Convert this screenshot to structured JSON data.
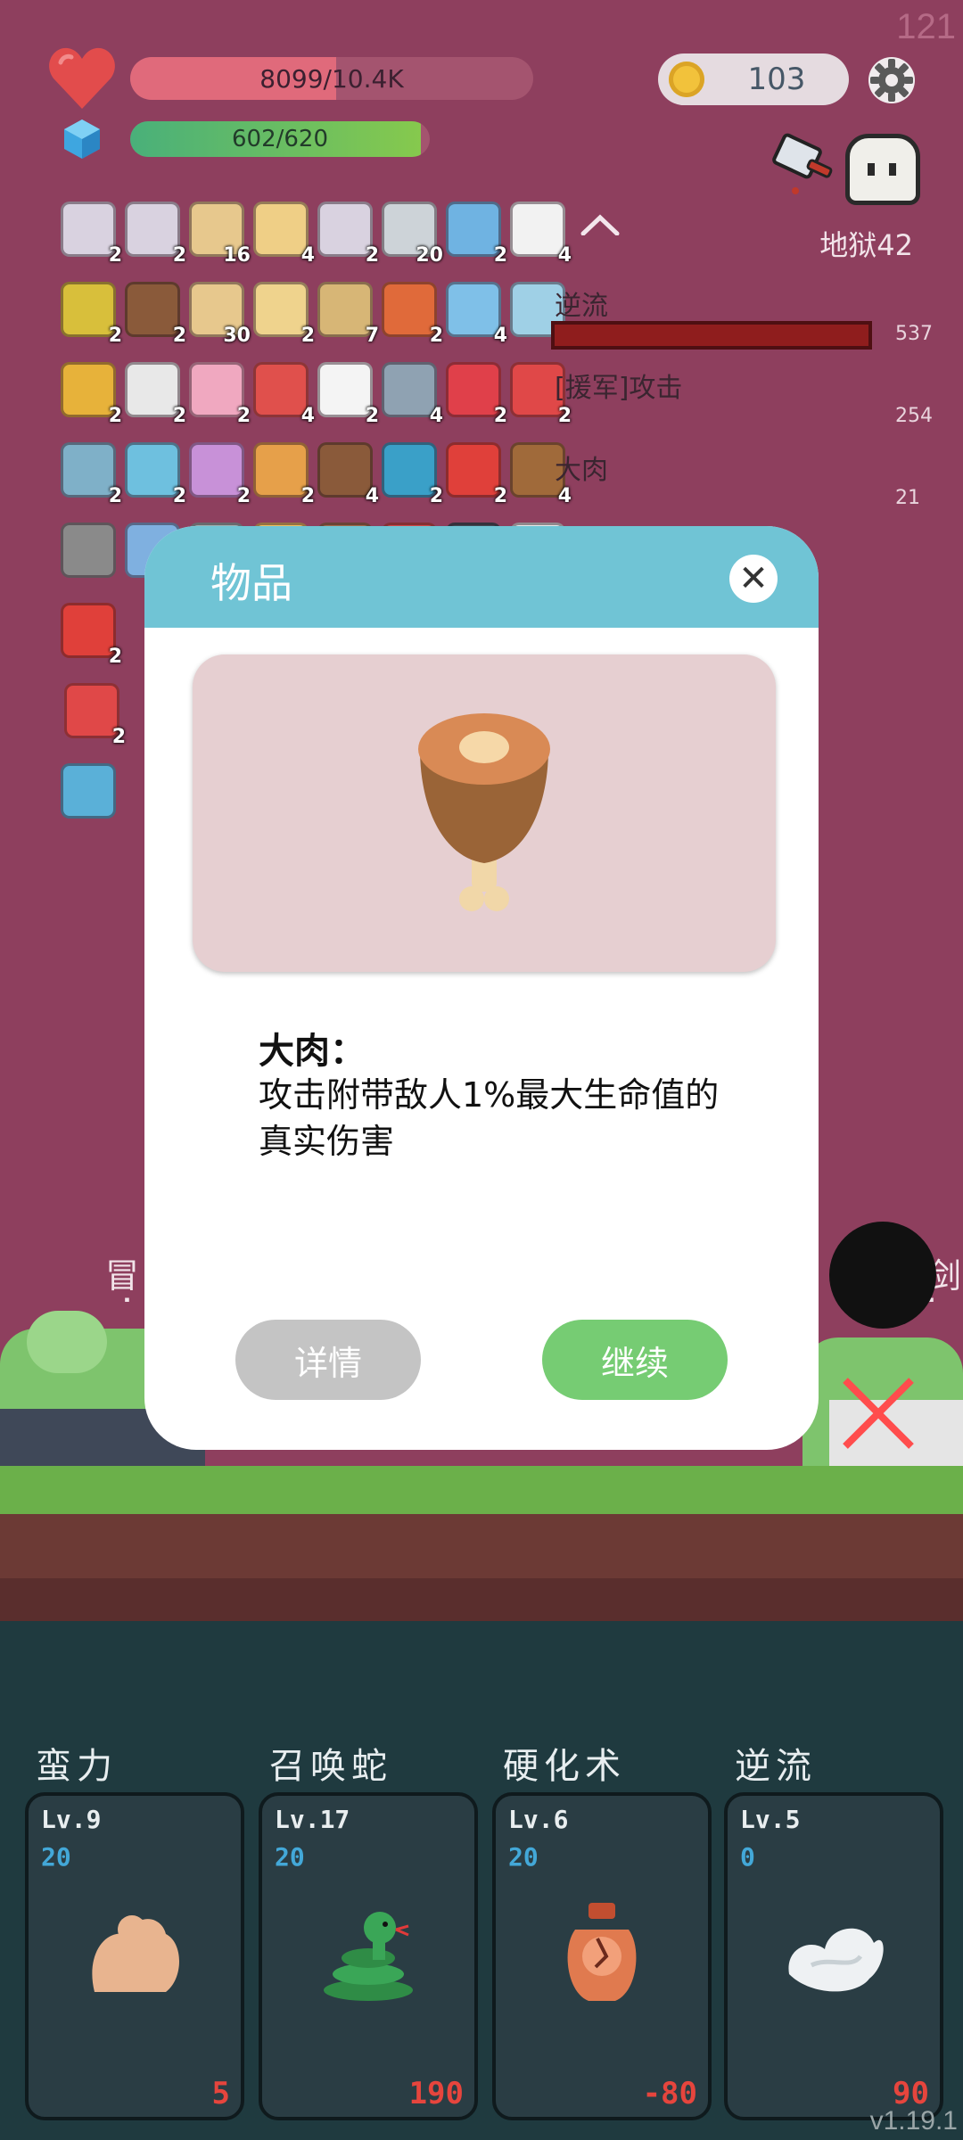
{
  "hud": {
    "fps": "121",
    "hp_text": "8099/10.4K",
    "hp_fraction": 0.51,
    "mp_text": "602/620",
    "mp_fraction": 0.97,
    "coins": "103",
    "stage": "地狱42"
  },
  "items": [
    {
      "icon": "scroll-card-icon",
      "color": "#d9d2e0",
      "count": "2"
    },
    {
      "icon": "scroll-card-icon",
      "color": "#d9d2e0",
      "count": "2"
    },
    {
      "icon": "map-scroll-icon",
      "color": "#e7c88d",
      "count": "16"
    },
    {
      "icon": "recipe-book-icon",
      "color": "#efcf86",
      "count": "4"
    },
    {
      "icon": "scroll-card-icon",
      "color": "#d9d2e0",
      "count": "2"
    },
    {
      "icon": "hook-icon",
      "color": "#cdd3d8",
      "count": "20"
    },
    {
      "icon": "star-card-icon",
      "color": "#6fb3e2",
      "count": "2"
    },
    {
      "icon": "flower-pot-icon",
      "color": "#f2f2f2",
      "count": "4"
    },
    {
      "icon": "durian-icon",
      "color": "#d8bf3b",
      "count": "2"
    },
    {
      "icon": "coconut-icon",
      "color": "#8a5a3a",
      "count": "2"
    },
    {
      "icon": "map-icon",
      "color": "#e7c88d",
      "count": "30"
    },
    {
      "icon": "paper-pen-icon",
      "color": "#efd38d",
      "count": "2"
    },
    {
      "icon": "treasure-map-icon",
      "color": "#d7b676",
      "count": "7"
    },
    {
      "icon": "meteor-icon",
      "color": "#e06a3a",
      "count": "2"
    },
    {
      "icon": "potion-icon",
      "color": "#7fc0e8",
      "count": "4"
    },
    {
      "icon": "syringe-icon",
      "color": "#9fd0e6",
      "count": "2"
    },
    {
      "icon": "pineapple-icon",
      "color": "#e7b23a",
      "count": "2"
    },
    {
      "icon": "playing-card-icon",
      "color": "#e8e8e8",
      "count": "2"
    },
    {
      "icon": "ice-cream-icon",
      "color": "#f0a8c0",
      "count": "2"
    },
    {
      "icon": "watermelon-icon",
      "color": "#e0504c",
      "count": "4"
    },
    {
      "icon": "ghost-icon",
      "color": "#f4f4f4",
      "count": "2"
    },
    {
      "icon": "sword-icon",
      "color": "#8fa2b2",
      "count": "4"
    },
    {
      "icon": "heart-icon",
      "color": "#e0404a",
      "count": "2"
    },
    {
      "icon": "sock-icon",
      "color": "#e04848",
      "count": "2"
    },
    {
      "icon": "tools-icon",
      "color": "#7fb0c8",
      "count": "2"
    },
    {
      "icon": "magnifier-icon",
      "color": "#6ec0df",
      "count": "2"
    },
    {
      "icon": "potted-flower-icon",
      "color": "#c891d8",
      "count": "2"
    },
    {
      "icon": "bread-icon",
      "color": "#e6a04a",
      "count": "2"
    },
    {
      "icon": "cake-icon",
      "color": "#8a5a3a",
      "count": "4"
    },
    {
      "icon": "spiral-tile-icon",
      "color": "#3aa0c8",
      "count": "2"
    },
    {
      "icon": "apple-icon",
      "color": "#e0403a",
      "count": "2"
    },
    {
      "icon": "pirate-ship-icon",
      "color": "#a06a3a",
      "count": "4"
    },
    {
      "icon": "tombstone-icon",
      "color": "#8a8a8a",
      "count": ""
    },
    {
      "icon": "shirt-icon",
      "color": "#7fb0e0",
      "count": ""
    },
    {
      "icon": "disc-icon",
      "color": "#9fb0b0",
      "count": ""
    },
    {
      "icon": "rainbow-icon",
      "color": "#f0c060",
      "count": ""
    },
    {
      "icon": "shield-round-icon",
      "color": "#a06a4a",
      "count": ""
    },
    {
      "icon": "shield-red-icon",
      "color": "#d04848",
      "count": ""
    },
    {
      "icon": "safe-icon",
      "color": "#404a55",
      "count": ""
    },
    {
      "icon": "envelope-icon",
      "color": "#e8e8e8",
      "count": ""
    },
    {
      "icon": "strawberry-icon",
      "color": "#e0403a",
      "count": "2"
    },
    {
      "icon": "bookmark-icon",
      "color": "#e04848",
      "count": "2"
    },
    {
      "icon": "lightbulb-tile-icon",
      "color": "#5ab0d8",
      "count": ""
    }
  ],
  "battle_log": [
    {
      "text": "逆流",
      "value": "537"
    },
    {
      "text": "[援军]攻击",
      "value": "254"
    },
    {
      "text": "大肉",
      "value": "21"
    }
  ],
  "ground_labels": {
    "left": "冒",
    "left_sub": "lv",
    "right": "剑",
    "right_sub": "lv."
  },
  "modal": {
    "title": "物品",
    "close_symbol": "✕",
    "item_icon": "meat-drumstick-icon",
    "item_name": "大肉：",
    "item_desc": "攻击附带敌人1%最大生命值的真实伤害",
    "detail_label": "详情",
    "continue_label": "继续"
  },
  "skills": [
    {
      "name": "蛮力",
      "level": "Lv.9",
      "sub": "20",
      "cost": "5",
      "icon": "muscle-arm-icon"
    },
    {
      "name": "召唤蛇",
      "level": "Lv.17",
      "sub": "20",
      "cost": "190",
      "icon": "snake-icon"
    },
    {
      "name": "硬化术",
      "level": "Lv.6",
      "sub": "20",
      "cost": "-80",
      "icon": "cracked-vase-icon"
    },
    {
      "name": "逆流",
      "level": "Lv.5",
      "sub": "0",
      "cost": "90",
      "icon": "wind-cloud-icon"
    }
  ],
  "version": "v1.19.1",
  "colors": {
    "accent_teal": "#70c4d5",
    "continue_green": "#76cc73",
    "detail_gray": "#c4c4c4",
    "bg_magenta": "#8e3f5e"
  }
}
